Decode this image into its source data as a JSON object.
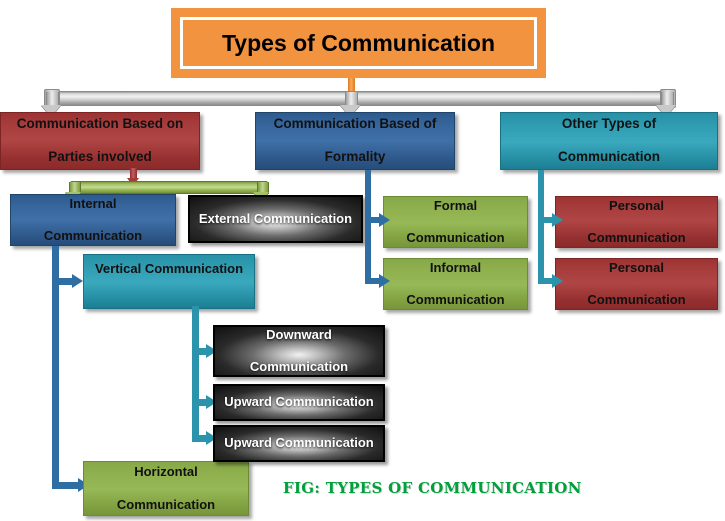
{
  "diagram": {
    "title": "Types of Communication",
    "caption": "FIG: TYPES OF COMMUNICATION",
    "colors": {
      "title_fill": "#F2933F",
      "title_border": "#FFFFFF",
      "red": "#A53B3B",
      "blue": "#3F70A8",
      "teal": "#3AA8BD",
      "green": "#97B856",
      "black": "#101010",
      "caption_green": "#00A03C",
      "connector_gray": "#C9C9C9",
      "connector_blue": "#2F6EA3",
      "connector_teal": "#2B93AB",
      "connector_green": "#A6C268",
      "connector_orange": "#EE8A2A",
      "connector_red": "#A33B3B"
    },
    "level1": [
      {
        "id": "parties",
        "label": "Communication Based on Parties involved",
        "line1": "Communication Based on",
        "line2": "Parties involved",
        "theme": "red"
      },
      {
        "id": "formality",
        "label": "Communication Based of Formality",
        "line1": "Communication Based of",
        "line2": "Formality",
        "theme": "blue"
      },
      {
        "id": "other",
        "label": "Other Types of Communication",
        "line1": "Other Types of",
        "line2": "Communication",
        "theme": "teal"
      }
    ],
    "level2": [
      {
        "id": "internal",
        "line1": "Internal",
        "line2": "Communication",
        "theme": "blue"
      },
      {
        "id": "external",
        "line1": "External Communication",
        "line2": "",
        "theme": "black"
      },
      {
        "id": "formal",
        "line1": "Formal",
        "line2": "Communication",
        "theme": "green"
      },
      {
        "id": "informal",
        "line1": "Informal",
        "line2": "Communication",
        "theme": "green"
      },
      {
        "id": "personal1",
        "line1": "Personal",
        "line2": "Communication",
        "theme": "red"
      },
      {
        "id": "personal2",
        "line1": "Personal",
        "line2": "Communication",
        "theme": "red"
      }
    ],
    "level3": [
      {
        "id": "vertical",
        "line1": "Vertical Communication",
        "line2": "",
        "theme": "teal"
      },
      {
        "id": "horizontal",
        "line1": "Horizontal",
        "line2": "Communication",
        "theme": "green"
      }
    ],
    "level4": [
      {
        "id": "downward",
        "line1": "Downward",
        "line2": "Communication",
        "theme": "black"
      },
      {
        "id": "upward1",
        "line1": "Upward Communication",
        "line2": "",
        "theme": "black"
      },
      {
        "id": "upward2",
        "line1": "Upward Communication",
        "line2": "",
        "theme": "black"
      }
    ]
  }
}
